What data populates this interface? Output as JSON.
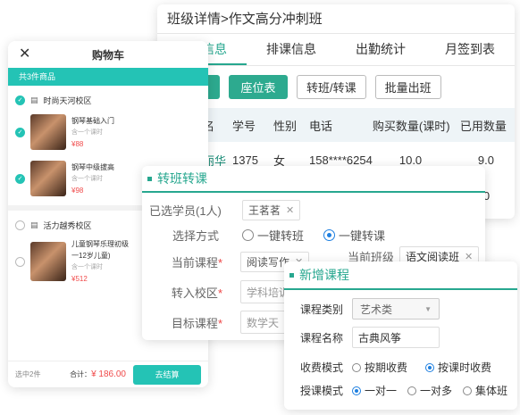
{
  "main": {
    "title": "班级详情>作文高分冲刺班",
    "tabs": [
      "学员信息",
      "排课信息",
      "出勤统计",
      "月签到表"
    ],
    "toolbar": [
      "分班",
      "座位表",
      "转班/转课",
      "批量出班"
    ],
    "table": {
      "headers": [
        "姓名",
        "学号",
        "性别",
        "电话",
        "购买数量(课时)",
        "已用数量"
      ],
      "rows": [
        [
          "李丽华",
          "1375",
          "女",
          "158****6254",
          "10.0",
          "9.0"
        ],
        [
          "",
          "",
          "",
          "",
          "",
          "0"
        ]
      ]
    }
  },
  "cart": {
    "title": "购物车",
    "count": "共3件商品",
    "shops": [
      {
        "name": "时尚天河校区",
        "items": [
          {
            "name": "钢琴基础入门",
            "count": "含一个课时",
            "price": "¥88"
          },
          {
            "name": "钢琴中级拔高",
            "count": "含一个课时",
            "price": "¥98"
          }
        ]
      },
      {
        "name": "活力越秀校区",
        "items": [
          {
            "name_line1": "儿童钢琴乐理初级",
            "name_line2": "一12岁儿童)",
            "count": "含一个课时",
            "price": "¥512"
          }
        ]
      }
    ],
    "footer": {
      "selected": "选中2件",
      "total_label": "合计：",
      "total_value": "¥ 186.00",
      "checkout": "去结算"
    }
  },
  "transfer": {
    "title": "转班转课",
    "selected_label": "已选学员(1人)",
    "selected_student": "王茗茗",
    "method_label": "选择方式",
    "method_options": [
      "一键转班",
      "一键转课"
    ],
    "current_course_label": "当前课程",
    "current_course": "阅读写作",
    "current_class_label": "当前班级",
    "current_class": "语文阅读班",
    "target_campus_label": "转入校区",
    "target_campus": "学科培训",
    "target_course_label": "目标课程",
    "target_course": "数学天"
  },
  "newcourse": {
    "title": "新增课程",
    "category_label": "课程类别",
    "category_value": "艺术类",
    "name_label": "课程名称",
    "name_value": "古典风筝",
    "fee_label": "收费模式",
    "fee_options": [
      "按期收费",
      "按课时收费"
    ],
    "teach_label": "授课模式",
    "teach_options": [
      "一对一",
      "一对多",
      "集体班"
    ]
  },
  "colors": {
    "accent": "#27a78f",
    "cart_accent": "#24c3b5",
    "price": "#f04a4a",
    "checkbox": "#1e7fe0"
  }
}
